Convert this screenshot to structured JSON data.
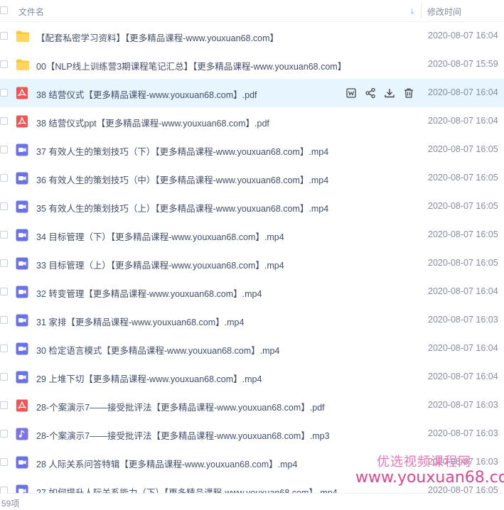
{
  "header": {
    "col_name": "文件名",
    "col_time": "修改时间",
    "sort_indicator": "↓"
  },
  "colors": {
    "folder": "#ffc936",
    "pdf": "#f05454",
    "video": "#6a72e8",
    "audio": "#7b73e8",
    "accent": "#06a7ff"
  },
  "files": [
    {
      "type": "folder",
      "name": "【配套私密学习资料】【更多精品课程-www.youxuan68.com】",
      "time": "2020-08-07 16:04"
    },
    {
      "type": "folder",
      "name": "00【NLP线上训练营3期课程笔记汇总】【更多精品课程-www.youxuan68.com】",
      "time": "2020-08-07 15:59"
    },
    {
      "type": "pdf",
      "name": "38 结营仪式【更多精品课程-www.youxuan68.com】.pdf",
      "time": "2020-08-07 16:04",
      "hover": true
    },
    {
      "type": "pdf",
      "name": "38 结营仪式ppt【更多精品课程-www.youxuan68.com】.pdf",
      "time": "2020-08-07 16:04"
    },
    {
      "type": "video",
      "name": "37 有效人生的策划技巧（下）【更多精品课程-www.youxuan68.com】.mp4",
      "time": "2020-08-07 16:05"
    },
    {
      "type": "video",
      "name": "36 有效人生的策划技巧（中）【更多精品课程-www.youxuan68.com】.mp4",
      "time": "2020-08-07 16:05"
    },
    {
      "type": "video",
      "name": "35 有效人生的策划技巧（上）【更多精品课程-www.youxuan68.com】.mp4",
      "time": "2020-08-07 16:05"
    },
    {
      "type": "video",
      "name": "34 目标管理（下）【更多精品课程-www.youxuan68.com】.mp4",
      "time": "2020-08-07 16:05"
    },
    {
      "type": "video",
      "name": "33 目标管理（上）【更多精品课程-www.youxuan68.com】.mp4",
      "time": "2020-08-07 16:05"
    },
    {
      "type": "video",
      "name": "32 转变管理【更多精品课程-www.youxuan68.com】.mp4",
      "time": "2020-08-07 16:04"
    },
    {
      "type": "video",
      "name": "31 家排【更多精品课程-www.youxuan68.com】.mp4",
      "time": "2020-08-07 16:03"
    },
    {
      "type": "video",
      "name": "30 检定语言模式【更多精品课程-www.youxuan68.com】.mp4",
      "time": "2020-08-07 16:04"
    },
    {
      "type": "video",
      "name": "29 上堆下切【更多精品课程-www.youxuan68.com】.mp4",
      "time": "2020-08-07 16:04"
    },
    {
      "type": "pdf",
      "name": "28-个案演示7——接受批评法【更多精品课程-www.youxuan68.com】.pdf",
      "time": "2020-08-07 16:03"
    },
    {
      "type": "audio",
      "name": "28-个案演示7——接受批评法【更多精品课程-www.youxuan68.com】.mp3",
      "time": "2020-08-07 16:03"
    },
    {
      "type": "video",
      "name": "28 人际关系问答特辑【更多精品课程-www.youxuan68.com】.mp4",
      "time": "2020-08-07 16:03"
    },
    {
      "type": "video",
      "name": "27 如何提升人际关系能力（下）【更多精品课程-www.youxuan68.com】.mp4",
      "time": "2020-08-07 16:05"
    }
  ],
  "footer": {
    "count": "59项"
  },
  "watermark": {
    "line1": "优选视频课程网",
    "line2": "www.youxuan68.com"
  }
}
